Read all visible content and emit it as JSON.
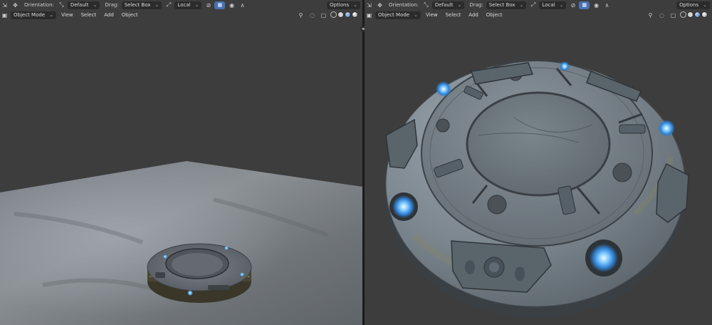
{
  "left": {
    "orientation_label": "Orientation:",
    "orientation_value": "Default",
    "drag_label": "Drag:",
    "drag_value": "Select Box",
    "pivot_value": "Local",
    "options_label": "Options",
    "mode_value": "Object Mode",
    "menu": [
      "View",
      "Select",
      "Add",
      "Object"
    ]
  },
  "right": {
    "orientation_label": "Orientation:",
    "orientation_value": "Default",
    "drag_label": "Drag:",
    "drag_value": "Select Box",
    "pivot_value": "Local",
    "options_label": "Options",
    "mode_value": "Object Mode",
    "menu": [
      "View",
      "Select",
      "Add",
      "Object"
    ]
  },
  "colors": {
    "viewport_bg": "#3d3d3d",
    "active_accent": "#4772b3",
    "light_glow": "#5ab8ff"
  },
  "icons": [
    "transform-icon",
    "move-icon",
    "snap-icon",
    "proportional-icon",
    "gizmo-icon",
    "overlay-icon",
    "xray-icon"
  ]
}
